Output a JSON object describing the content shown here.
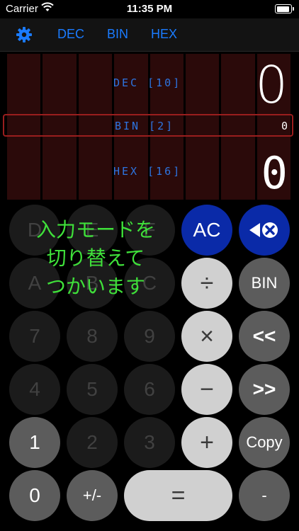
{
  "status": {
    "carrier": "Carrier",
    "time": "11:35 PM"
  },
  "nav": {
    "tabs": [
      "DEC",
      "BIN",
      "HEX"
    ]
  },
  "display": {
    "dec": {
      "label": "DEC [10]",
      "value": "0"
    },
    "bin": {
      "label": "BIN [2]",
      "value": "0"
    },
    "hex": {
      "label": "HEX [16]",
      "value": "0"
    }
  },
  "overlay": {
    "lines": [
      "入力モードを",
      "切り替えて",
      "つかいます"
    ]
  },
  "keys": {
    "d": "D",
    "e": "E",
    "f": "F",
    "a": "A",
    "b": "B",
    "c": "C",
    "ac": "AC",
    "divide": "÷",
    "bin": "BIN",
    "multiply": "×",
    "shl": "<<",
    "n7": "7",
    "n8": "8",
    "n9": "9",
    "n4": "4",
    "n5": "5",
    "n6": "6",
    "minus": "−",
    "shr": ">>",
    "n1": "1",
    "n2": "2",
    "n3": "3",
    "plus": "+",
    "copy": "Copy",
    "n0": "0",
    "sign": "+/-",
    "equals": "=",
    "dash": "-"
  },
  "colors": {
    "accent": "#1a7bff",
    "ac": "#0a2aa8",
    "overlay_text": "#3fe03a",
    "bin_frame": "#9a1e1e"
  }
}
